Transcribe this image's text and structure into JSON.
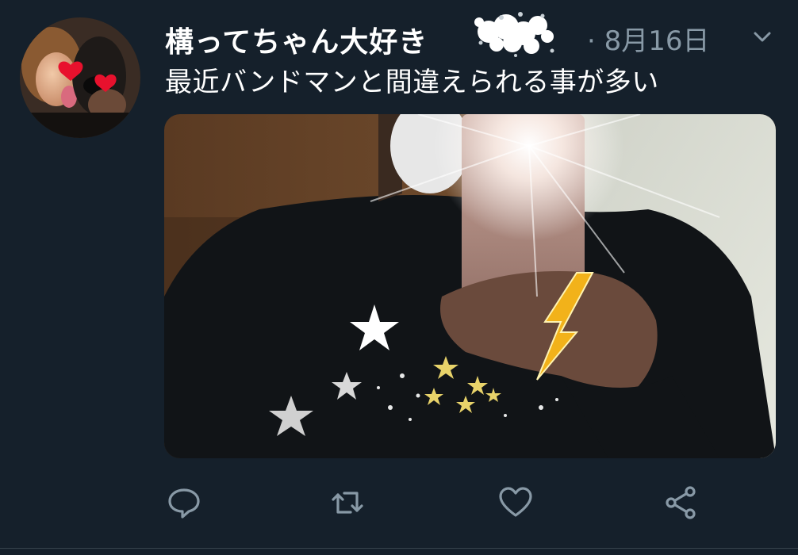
{
  "tweet": {
    "display_name": "構ってちゃん大好き",
    "timestamp": "· 8月16日",
    "text": "最近バンドマンと間違えられる事が多い"
  },
  "icons": {
    "avatar": "avatar",
    "menu": "chevron-down-icon",
    "reply": "reply-icon",
    "retweet": "retweet-icon",
    "like": "heart-icon",
    "share": "share-icon"
  },
  "colors": {
    "background": "#15202b",
    "primary_text": "#ffffff",
    "secondary_text": "#8899a6"
  }
}
